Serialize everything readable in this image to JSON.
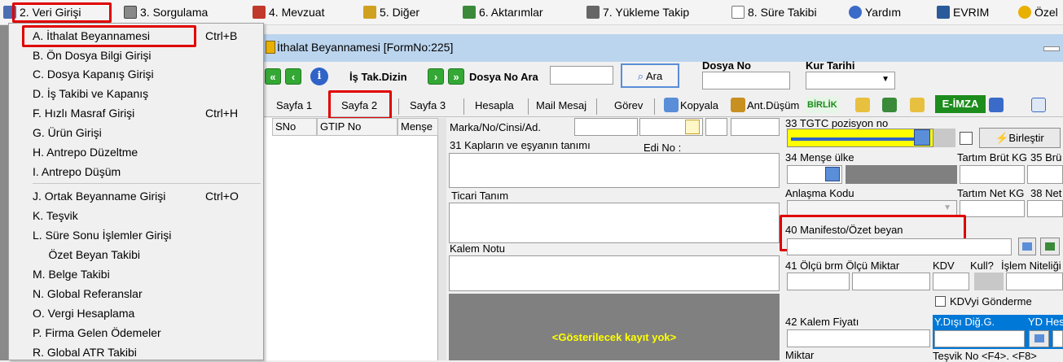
{
  "menubar": {
    "items": [
      {
        "label": "2.  Veri Girişi",
        "icon": "data-entry-icon",
        "color": "#4a6fb3"
      },
      {
        "label": "3.  Sorgulama",
        "icon": "query-icon",
        "color": "#555555"
      },
      {
        "label": "4.  Mevzuat",
        "icon": "books-icon",
        "color": "#c0392b"
      },
      {
        "label": "5.  Diğer",
        "icon": "tools-icon",
        "color": "#d0a020"
      },
      {
        "label": "6.  Aktarımlar",
        "icon": "transfer-icon",
        "color": "#3a8a3a"
      },
      {
        "label": "7.  Yükleme Takip",
        "icon": "tracking-icon",
        "color": "#666666"
      },
      {
        "label": "8. Süre Takibi",
        "icon": "calendar-icon",
        "color": "#777777"
      },
      {
        "label": "Yardım",
        "icon": "help-icon",
        "color": "#3a6bc8"
      },
      {
        "label": "EVRIM",
        "icon": "evrim-icon",
        "color": "#2a5a9a"
      },
      {
        "label": "Özel",
        "icon": "star-icon",
        "color": "#e8b000"
      }
    ]
  },
  "dropdown": {
    "items": [
      {
        "label": "A.  İthalat Beyannamesi",
        "shortcut": "Ctrl+B"
      },
      {
        "label": "B.  Ön Dosya Bilgi Girişi",
        "shortcut": ""
      },
      {
        "label": "C.  Dosya Kapanış Girişi",
        "shortcut": ""
      },
      {
        "label": "D.  İş Takibi ve Kapanış",
        "shortcut": ""
      },
      {
        "label": "F.  Hızlı Masraf Girişi",
        "shortcut": "Ctrl+H"
      },
      {
        "label": "G.  Ürün Girişi",
        "shortcut": ""
      },
      {
        "label": "H.  Antrepo Düzeltme",
        "shortcut": ""
      },
      {
        "label": "I.   Antrepo Düşüm",
        "shortcut": ""
      },
      {
        "label": "J.  Ortak Beyanname Girişi",
        "shortcut": "Ctrl+O"
      },
      {
        "label": "K.  Teşvik",
        "shortcut": ""
      },
      {
        "label": "L.   Süre Sonu İşlemler Girişi",
        "shortcut": ""
      },
      {
        "label": "     Özet Beyan Takibi",
        "shortcut": ""
      },
      {
        "label": "M.   Belge Takibi",
        "shortcut": ""
      },
      {
        "label": "N.  Global Referanslar",
        "shortcut": ""
      },
      {
        "label": "O. Vergi Hesaplama",
        "shortcut": ""
      },
      {
        "label": "P. Firma Gelen Ödemeler",
        "shortcut": ""
      },
      {
        "label": "R. Global ATR Takibi",
        "shortcut": ""
      }
    ]
  },
  "window": {
    "title": "İthalat Beyannamesi [FormNo:225]",
    "is_tak_dizin": "İş Tak.Dizin",
    "dosya_no_ara": "Dosya No Ara",
    "ara_button": "Ara",
    "dosya_no_label": "Dosya No",
    "kur_tarihi_label": "Kur Tarihi",
    "info_glyph": "i"
  },
  "tabs": {
    "items": [
      "Sayfa 1",
      "Sayfa 2",
      "Sayfa 3",
      "Hesapla",
      "Mail Mesaj",
      "Görev",
      "Kopyala",
      "Ant.Düşüm"
    ],
    "birlik": "BİRLİK",
    "eimza": "E-İMZA"
  },
  "grid": {
    "columns": [
      "SNo",
      "GTIP No",
      "Menşe"
    ]
  },
  "form": {
    "marka": "Marka/No/Cinsi/Ad.",
    "kaplar": "31 Kapların ve eşyanın tanımı",
    "edi_no": "Edi No :",
    "ticari_tanim": "Ticari Tanım",
    "kalem_notu": "Kalem Notu",
    "no_records": "<Gösterilecek kayıt yok>",
    "tgtc": "33 TGTC pozisyon no",
    "birlestir": "Birleştir",
    "mense_ulke": "34 Menşe ülke",
    "tartim_brut": "Tartım Brüt KG",
    "brut_35": "35 Brü",
    "anlasma_kodu": "Anlaşma Kodu",
    "tartim_net": "Tartım Net KG",
    "net_38": "38 Net",
    "manifesto": "40 Manifesto/Özet beyan",
    "olcu_brm": "41 Ölçü brm Ölçü Miktar",
    "kdv": "KDV",
    "kull": "Kull?",
    "islem_niteligi": "İşlem Niteliği",
    "kdv_gonderme": "KDVyi Gönderme",
    "kalem_fiyati": "42 Kalem Fiyatı",
    "ydisi": "Y.Dışı Diğ.G.",
    "yd_hes": "YD Hes",
    "miktar": "Miktar",
    "tesvik_no": "Teşvik No <F4>. <F8>"
  },
  "colors": {
    "highlight": "#e00000",
    "title_bar": "#bcd5ee",
    "yellow_field": "#ffff00",
    "no_records_bg": "#808080",
    "no_records_text": "#ffff00",
    "selected_blue": "#0078d7"
  }
}
